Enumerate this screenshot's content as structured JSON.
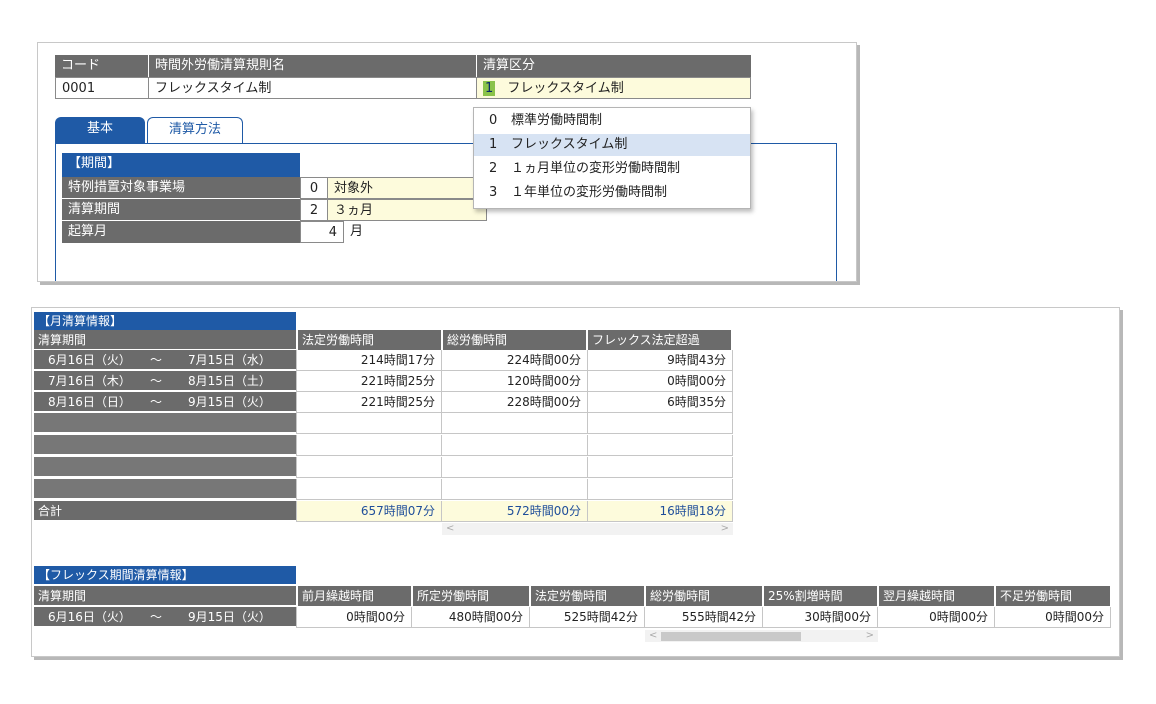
{
  "top": {
    "headers": {
      "code": "コード",
      "name": "時間外労働清算規則名",
      "kubun": "清算区分"
    },
    "row": {
      "code": "0001",
      "name": "フレックスタイム制",
      "kubun_code": "1",
      "kubun_label": "フレックスタイム制"
    },
    "tabs": [
      {
        "label": "基本"
      },
      {
        "label": "清算方法"
      }
    ],
    "section_title": "【期間】",
    "fields": [
      {
        "label": "特例措置対象事業場",
        "code": "0",
        "value": "対象外"
      },
      {
        "label": "清算期間",
        "code": "2",
        "value": "３ヵ月"
      },
      {
        "label": "起算月",
        "code": "4",
        "value": "月"
      }
    ],
    "dropdown": [
      {
        "code": "0",
        "label": "標準労働時間制"
      },
      {
        "code": "1",
        "label": "フレックスタイム制"
      },
      {
        "code": "2",
        "label": "１ヵ月単位の変形労働時間制"
      },
      {
        "code": "3",
        "label": "１年単位の変形労働時間制"
      }
    ]
  },
  "monthly": {
    "title": "【月清算情報】",
    "row_header": "清算期間",
    "columns": [
      "法定労働時間",
      "総労働時間",
      "フレックス法定超過"
    ],
    "rows": [
      {
        "from": "6月16日（火）",
        "sep": "～",
        "to": "7月15日（水）",
        "vals": [
          "214時間17分",
          "224時間00分",
          "9時間43分"
        ]
      },
      {
        "from": "7月16日（木）",
        "sep": "～",
        "to": "8月15日（土）",
        "vals": [
          "221時間25分",
          "120時間00分",
          "0時間00分"
        ]
      },
      {
        "from": "8月16日（日）",
        "sep": "～",
        "to": "9月15日（火）",
        "vals": [
          "221時間25分",
          "228時間00分",
          "6時間35分"
        ]
      }
    ],
    "total_label": "合計",
    "totals": [
      "657時間07分",
      "572時間00分",
      "16時間18分"
    ]
  },
  "flex": {
    "title": "【フレックス期間清算情報】",
    "row_header": "清算期間",
    "columns": [
      "前月繰越時間",
      "所定労働時間",
      "法定労働時間",
      "総労働時間",
      "25%割増時間",
      "翌月繰越時間",
      "不足労働時間"
    ],
    "row": {
      "from": "6月16日（火）",
      "sep": "～",
      "to": "9月15日（火）",
      "vals": [
        "0時間00分",
        "480時間00分",
        "525時間42分",
        "555時間42分",
        "30時間00分",
        "0時間00分",
        "0時間00分"
      ]
    }
  },
  "scroll": {
    "left": "<",
    "right": ">"
  },
  "colors": {
    "header_gray": "#6b6b6b",
    "accent_blue": "#1f5aa6",
    "input_yellow": "#fdfbdc",
    "selected_row": "#d7e3f3"
  }
}
